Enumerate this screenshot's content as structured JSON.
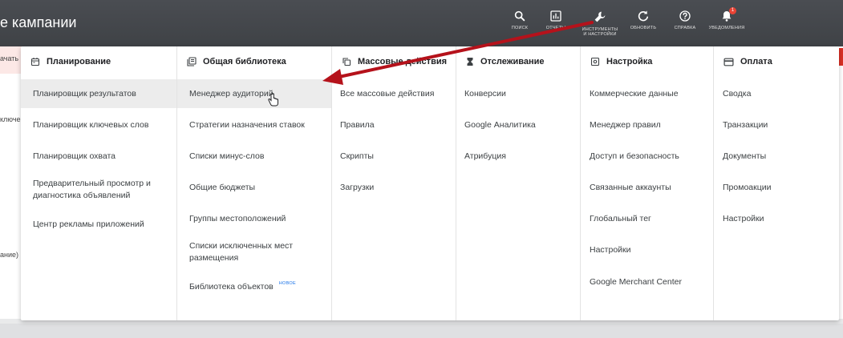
{
  "app": {
    "title": "е кампании"
  },
  "toolbar": {
    "search_label": "ПОИСК",
    "reports_label": "ОТЧЕТЫ",
    "tools_label_line1": "ИНСТРУМЕНТЫ",
    "tools_label_line2": "И НАСТРОЙКИ",
    "refresh_label": "ОБНОВИТЬ",
    "help_label": "СПРАВКА",
    "notifications_label": "УВЕДОМЛЕНИЯ",
    "notifications_count": "1"
  },
  "background": {
    "frag1": "ачать",
    "frag2": "ключе",
    "frag3": "ание)"
  },
  "menu": {
    "columns": [
      {
        "header": "Планирование",
        "icon": "calendar-icon",
        "items": [
          "Планировщик результатов",
          "Планировщик ключевых слов",
          "Планировщик охвата",
          "Предварительный просмотр и диагностика объявлений",
          "Центр рекламы приложений"
        ]
      },
      {
        "header": "Общая библиотека",
        "icon": "library-icon",
        "items": [
          "Менеджер аудиторий",
          "Стратегии назначения ставок",
          "Списки минус-слов",
          "Общие бюджеты",
          "Группы местоположений",
          "Списки исключенных мест размещения",
          "Библиотека объектов"
        ],
        "new_badge": "НОВОЕ"
      },
      {
        "header": "Массовые действия",
        "icon": "copy-icon",
        "items": [
          "Все массовые действия",
          "Правила",
          "Скрипты",
          "Загрузки"
        ]
      },
      {
        "header": "Отслеживание",
        "icon": "hourglass-icon",
        "items": [
          "Конверсии",
          "Google Аналитика",
          "Атрибуция"
        ]
      },
      {
        "header": "Настройка",
        "icon": "settings-box-icon",
        "items": [
          "Коммерческие данные",
          "Менеджер правил",
          "Доступ и безопасность",
          "Связанные аккаунты",
          "Глобальный тег",
          "Настройки",
          "Google Merchant Center"
        ]
      },
      {
        "header": "Оплата",
        "icon": "credit-card-icon",
        "items": [
          "Сводка",
          "Транзакции",
          "Документы",
          "Промоакции",
          "Настройки"
        ]
      }
    ]
  },
  "colors": {
    "topbar": "#3f4246",
    "arrow": "#b5121b",
    "active_item": "#ececec",
    "accent": "#1a73e8"
  }
}
